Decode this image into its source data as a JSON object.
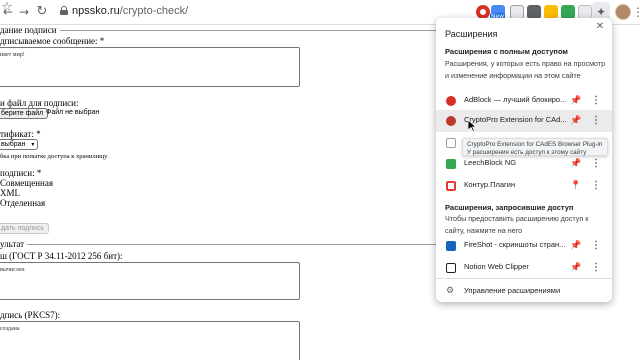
{
  "browser": {
    "url_host": "npssko.ru",
    "url_path": "/crypto-check/",
    "new_badge": "New"
  },
  "page": {
    "section_create_title": "дание подписи",
    "message_label": "дписываемое сообщение: *",
    "message_value": "ивет мир!",
    "file_label": "и файл для подписи:",
    "file_button": "берите файл",
    "file_status": "Файл не выбран",
    "cert_label": "тификат: *",
    "cert_select": "выбран",
    "cert_error": "бка при попытке доступа к хранилищу",
    "sig_type_label": "подписи: *",
    "sig_type_options": [
      "Совмещенная",
      "XML",
      "Отделенная"
    ],
    "sign_button": "дать подпись",
    "result_title": "ультат",
    "hash_label": "ш (ГОСТ Р 34.11-2012 256 бит):",
    "hash_value": "вычислен",
    "signature_label": "дпись (PKCS7):",
    "signature_value": "создана",
    "required_mark": "*"
  },
  "extensions_popup": {
    "title": "Расширения",
    "full_access_heading": "Расширения с полным доступом",
    "full_access_desc": "Расширения, у которых есть право на просмотр и изменение информации на этом сайте",
    "full_access_items": [
      {
        "name": "AdBlock — лучший блокиро...",
        "pinned": true,
        "icon_color": "#d93025"
      },
      {
        "name": "CryptoPro Extension for CAd...",
        "pinned": true,
        "icon_color": "#c0392b"
      },
      {
        "name": "",
        "pinned": true,
        "icon_color": "#9aa0a6"
      },
      {
        "name": "LeechBlock NG",
        "pinned": true,
        "icon_color": "#34a853"
      },
      {
        "name": "Контур.Плагин",
        "pinned": false,
        "icon_color": "#e53935"
      }
    ],
    "request_access_heading": "Расширения, запросившие доступ",
    "request_access_desc": "Чтобы предоставить расширению доступ к сайту, нажмите на него",
    "request_access_items": [
      {
        "name": "FireShot - скриншоты стран...",
        "pinned": true,
        "icon_color": "#1565c0"
      },
      {
        "name": "Notion Web Clipper",
        "pinned": true,
        "icon_color": "#202124"
      }
    ],
    "manage_label": "Управление расширениями",
    "tooltip_line1": "CryptoPro Extension for CAdES Browser Plug-in",
    "tooltip_line2": "У расширения есть доступ к этому сайту"
  },
  "icons": {
    "back": "arrow-left-icon",
    "forward": "arrow-right-icon",
    "reload": "reload-icon",
    "lock": "lock-icon",
    "star": "star-icon",
    "puzzle": "puzzle-icon",
    "pin": "pin-icon",
    "more": "more-vert-icon",
    "gear": "gear-icon",
    "close": "close-icon"
  }
}
